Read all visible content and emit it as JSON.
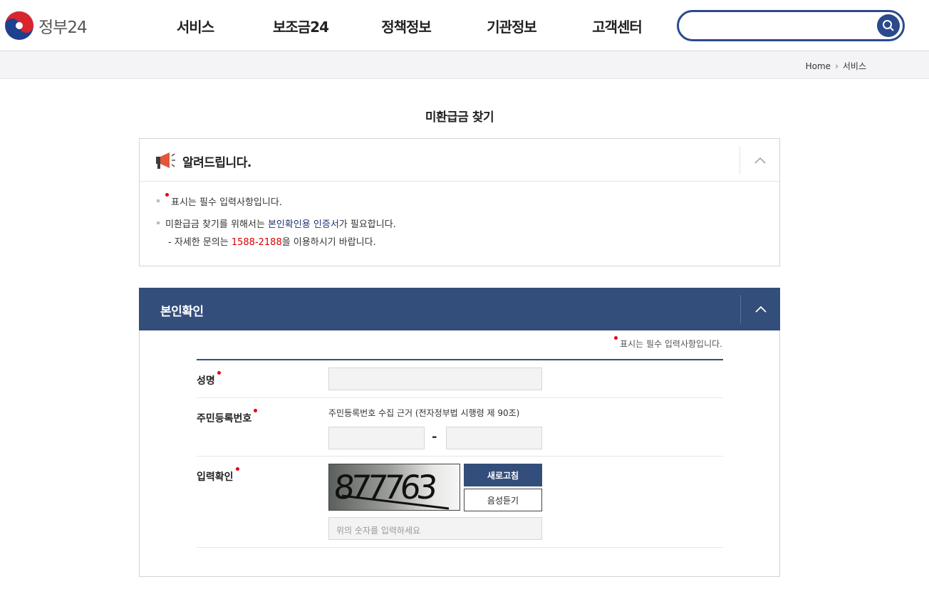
{
  "header": {
    "logo_text": "정부24",
    "nav": [
      "서비스",
      "보조금24",
      "정책정보",
      "기관정보",
      "고객센터"
    ],
    "search_placeholder": ""
  },
  "breadcrumb": {
    "home": "Home",
    "current": "서비스"
  },
  "page_title": "미환급금 찾기",
  "notice": {
    "title": "알려드립니다.",
    "line1": "표시는 필수 입력사항입니다.",
    "line2_a": "미환급금 찾기를 위해서는 ",
    "line2_b": "본인확인용 인증서",
    "line2_c": "가 필요합니다.",
    "line3_a": "- 자세한 문의는 ",
    "line3_phone": "1588-2188",
    "line3_b": "을 이용하시기 바랍니다."
  },
  "verify": {
    "title": "본인확인",
    "required_note": "표시는 필수 입력사항입니다.",
    "name_label": "성명",
    "rrn_label": "주민등록번호",
    "rrn_hint": "주민등록번호 수집 근거 (전자정부법 시행령 제 90조)",
    "rrn_dash": "-",
    "captcha_label": "입력확인",
    "captcha_text": "877763",
    "refresh_label": "새로고침",
    "audio_label": "음성듣기",
    "captcha_placeholder": "위의 숫자를 입력하세요"
  },
  "colors": {
    "primary": "#344e7b",
    "accent_red": "#d90000",
    "search_border": "#2b4a8c"
  }
}
